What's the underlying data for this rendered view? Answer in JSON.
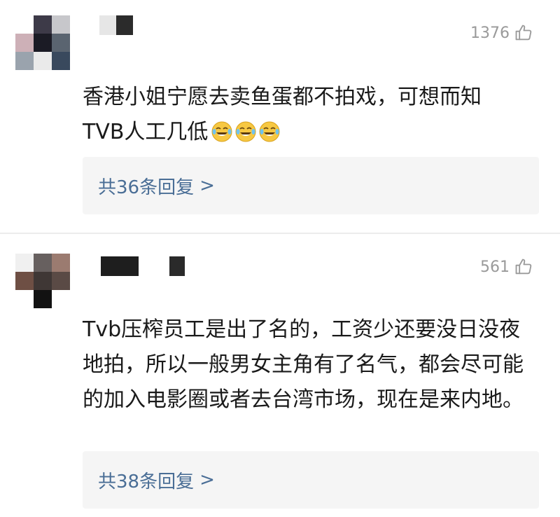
{
  "comments": [
    {
      "likes": "1376",
      "text": "香港小姐宁愿去卖鱼蛋都不拍戏，可想而知\nTVB人工几低",
      "emoji": "tears-of-joy",
      "replies_label": "共36条回复",
      "replies_chevron": ">"
    },
    {
      "likes": "561",
      "text": "Tvb压榨员工是出了名的，工资少还要没日没夜地拍，所以一般男女主角有了名气，都会尽可能的加入电影圈或者去台湾市场，现在是来内地。",
      "replies_label": "共38条回复",
      "replies_chevron": ">"
    }
  ],
  "colors": {
    "reply_link": "#4a6e96",
    "reply_bg": "#f5f5f5",
    "like_gray": "#9a9a9a"
  },
  "icons": {
    "like": "thumbs-up-outline-icon",
    "emoji": "face-with-tears-of-joy"
  }
}
